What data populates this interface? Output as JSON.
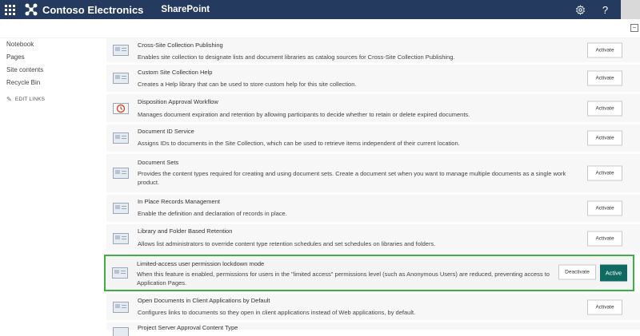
{
  "suite": {
    "brand_name": "Contoso Electronics",
    "app_name": "SharePoint",
    "settings_icon": "gear-icon",
    "help_label": "?"
  },
  "leftnav": {
    "items": [
      "Notebook",
      "Pages",
      "Site contents",
      "Recycle Bin"
    ],
    "edit_links": "EDIT LINKS"
  },
  "features": [
    {
      "title": "Cross-Site Collection Publishing",
      "description": "Enables site collection to designate lists and document libraries as catalog sources for Cross-Site Collection Publishing.",
      "button": "Activate",
      "icon": "feature-icon"
    },
    {
      "title": "Custom Site Collection Help",
      "description": "Creates a Help library that can be used to store custom help for this site collection.",
      "button": "Activate",
      "icon": "feature-icon"
    },
    {
      "title": "Disposition Approval Workflow",
      "description": "Manages document expiration and retention by allowing participants to decide whether to retain or delete expired documents.",
      "button": "Activate",
      "icon": "workflow-icon"
    },
    {
      "title": "Document ID Service",
      "description": "Assigns IDs to documents in the Site Collection, which can be used to retrieve items independent of their current location.",
      "button": "Activate",
      "icon": "feature-icon"
    },
    {
      "title": "Document Sets",
      "description": "Provides the content types required for creating and using document sets. Create a document set when you want to manage multiple documents as a single work product.",
      "button": "Activate",
      "icon": "feature-icon"
    },
    {
      "title": "In Place Records Management",
      "description": "Enable the definition and declaration of records in place.",
      "button": "Activate",
      "icon": "feature-icon"
    },
    {
      "title": "Library and Folder Based Retention",
      "description": "Allows list administrators to override content type retention schedules and set schedules on libraries and folders.",
      "button": "Activate",
      "icon": "feature-icon"
    },
    {
      "title": "Limited-access user permission lockdown mode",
      "description": "When this feature is enabled, permissions for users in the \"limited access\" permissions level (such as Anonymous Users) are reduced, preventing access to Application Pages.",
      "deactivate_button": "Deactivate",
      "status": "Active",
      "highlight_color": "#3cb043",
      "icon": "feature-icon"
    },
    {
      "title": "Open Documents in Client Applications by Default",
      "description": "Configures links to documents so they open in client applications instead of Web applications, by default.",
      "button": "Activate",
      "icon": "feature-icon"
    },
    {
      "title": "Project Server Approval Content Type",
      "description": "",
      "button": "",
      "icon": "feature-icon"
    }
  ],
  "colors": {
    "suite_bar": "#243a5e",
    "active_button": "#0f6b62",
    "highlight_border": "#3cb043"
  }
}
